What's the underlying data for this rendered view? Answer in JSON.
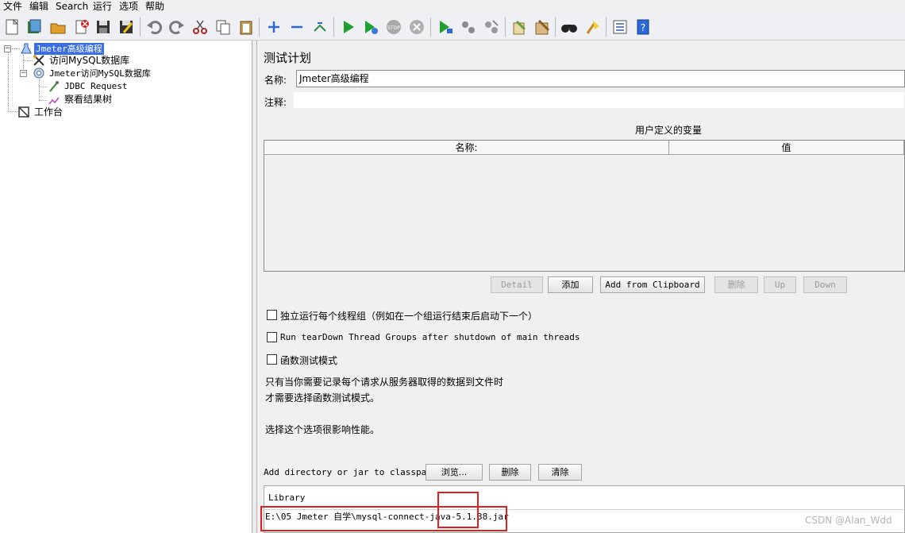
{
  "menu": [
    "文件",
    "编辑",
    "Search",
    "运行",
    "选项",
    "帮助"
  ],
  "toolbar_icons": [
    "new-icon",
    "templates-icon",
    "open-icon",
    "close-icon",
    "save-icon",
    "save-as-icon",
    "undo-icon",
    "redo-icon",
    "cut-icon",
    "copy-icon",
    "paste-icon",
    "expand-icon",
    "collapse-icon",
    "toggle-icon",
    "start-icon",
    "start-no-pause-icon",
    "stop-icon",
    "shutdown-icon",
    "remote-start-icon",
    "remote-stop-icon",
    "remote-exit-icon",
    "clear-icon",
    "clear-all-icon",
    "search-icon",
    "reset-search-icon",
    "function-helper-icon",
    "help-icon"
  ],
  "tree": {
    "root": "Jmeter高级编程",
    "items": [
      "访问MySQL数据库",
      "Jmeter访问MySQL数据库",
      "JDBC Request",
      "察看结果树"
    ],
    "workbench": "工作台"
  },
  "panel": {
    "title": "测试计划",
    "name_label": "名称:",
    "name_value": "Jmeter高级编程",
    "comment_label": "注释:",
    "comment_value": "",
    "vars_title": "用户定义的变量",
    "col_name": "名称:",
    "col_value": "值",
    "buttons": {
      "detail": "Detail",
      "add": "添加",
      "add_clipboard": "Add from Clipboard",
      "delete": "删除",
      "up": "Up",
      "down": "Down"
    },
    "checkboxes": {
      "serialize": "独立运行每个线程组（例如在一个组运行结束后启动下一个）",
      "teardown": "Run tearDown Thread Groups after shutdown of main threads",
      "functional": "函数测试模式"
    },
    "note_line1": "只有当你需要记录每个请求从服务器取得的数据到文件时",
    "note_line2": "才需要选择函数测试模式。",
    "note_line3": "选择这个选项很影响性能。",
    "classpath_label": "Add directory or jar to classpath",
    "browse": "浏览...",
    "cp_delete": "删除",
    "cp_clear": "清除",
    "library_header": "Library",
    "library_row": "E:\\05 Jmeter 自学\\mysql-connect-java-5.1.38.jar"
  },
  "watermark": "CSDN @Alan_Wdd"
}
